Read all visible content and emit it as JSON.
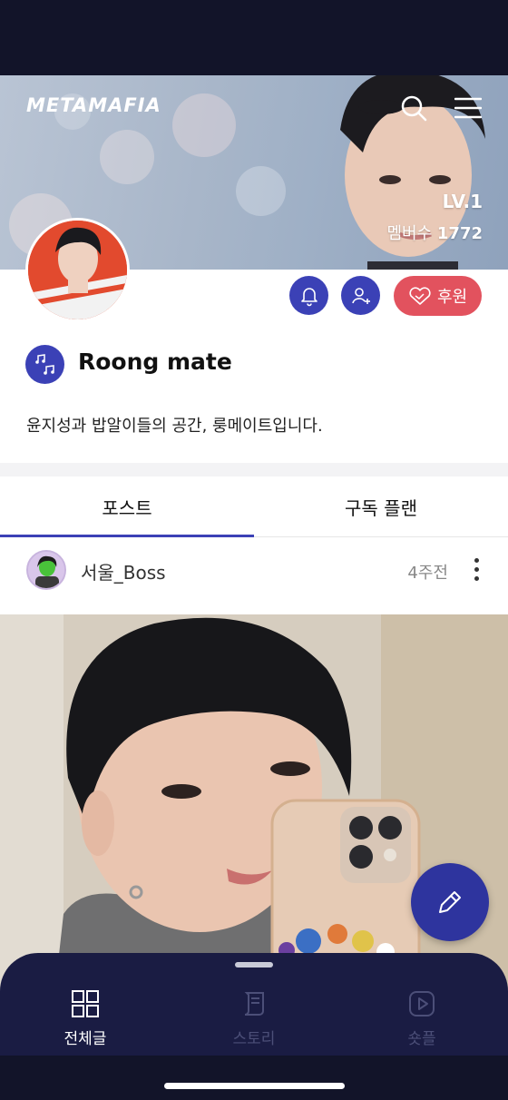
{
  "header": {
    "logo": "METAMAFIA",
    "level": "LV.1",
    "members_label": "멤버수",
    "members_count": "1772"
  },
  "actions": {
    "sponsor_label": "후원"
  },
  "community": {
    "name": "Roong mate",
    "description": "윤지성과 밥알이들의 공간, 룽메이트입니다."
  },
  "tabs": [
    {
      "label": "포스트",
      "active": true
    },
    {
      "label": "구독 플랜",
      "active": false
    }
  ],
  "post": {
    "author": "서울_Boss",
    "time": "4주전"
  },
  "bottom_nav": [
    {
      "label": "전체글",
      "icon": "grid-icon",
      "active": true
    },
    {
      "label": "스토리",
      "icon": "scroll-icon",
      "active": false
    },
    {
      "label": "숏플",
      "icon": "play-icon",
      "active": false
    }
  ],
  "colors": {
    "accent": "#3b41b6",
    "sponsor": "#e2525e",
    "dark": "#1a1c43"
  }
}
